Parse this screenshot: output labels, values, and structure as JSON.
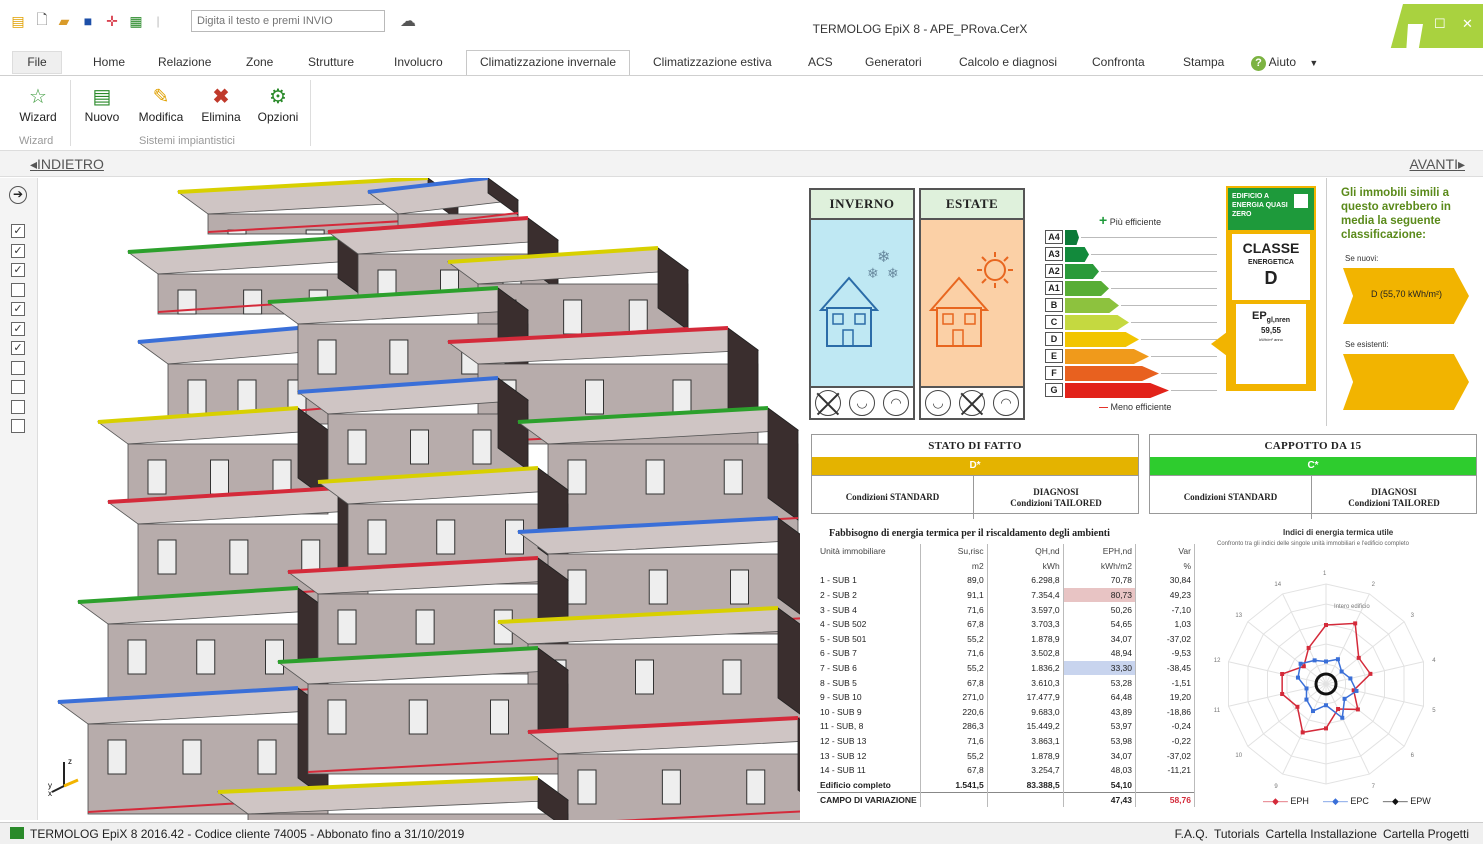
{
  "titlebar": {
    "search_placeholder": "Digita il testo e premi INVIO",
    "window_title": "TERMOLOG EpiX 8 - APE_PRova.CerX"
  },
  "tabs": [
    "File",
    "Home",
    "Relazione",
    "Zone",
    "Strutture",
    "Involucro",
    "Climatizzazione invernale",
    "Climatizzazione estiva",
    "ACS",
    "Generatori",
    "Calcolo e diagnosi",
    "Confronta",
    "Stampa"
  ],
  "help_label": "Aiuto",
  "ribbon": {
    "wizard": "Wizard",
    "nuovo": "Nuovo",
    "modifica": "Modifica",
    "elimina": "Elimina",
    "opzioni": "Opzioni",
    "group_wizard": "Wizard",
    "group_sistemi": "Sistemi impiantistici"
  },
  "nav": {
    "back": "INDIETRO",
    "next": "AVANTI"
  },
  "checkboxes": [
    true,
    true,
    true,
    false,
    true,
    true,
    true,
    false,
    false,
    false,
    false
  ],
  "season": {
    "winter": "INVERNO",
    "summer": "ESTATE",
    "winter_faces": [
      "x",
      "neutral",
      "sad"
    ],
    "summer_faces": [
      "neutral",
      "x",
      "sad"
    ],
    "winter_color": "#bfe8f3",
    "summer_color": "#fbd0a6"
  },
  "energy_scale": {
    "more_efficient": "Più efficiente",
    "less_efficient": "Meno efficiente",
    "classes": [
      "A4",
      "A3",
      "A2",
      "A1",
      "B",
      "C",
      "D",
      "E",
      "F",
      "G"
    ],
    "colors": [
      "#0b7a38",
      "#128a3c",
      "#2a9a3a",
      "#58ad35",
      "#8dc23e",
      "#c5d940",
      "#f2c500",
      "#f09a1b",
      "#e8611f",
      "#e2231a"
    ]
  },
  "classe": {
    "nzeb": "EDIFICIO A ENERGIA QUASI ZERO",
    "classe_label": "CLASSE",
    "energetica": "ENERGETICA",
    "value": "D",
    "ep_label": "EP",
    "ep_sub": "gl,nren",
    "ep_value": "59,55",
    "ep_unit": "kWh/m² anno"
  },
  "similar": {
    "heading": "Gli immobili simili a questo avrebbero in media la seguente classificazione:",
    "new_label": "Se nuovi:",
    "new_value": "D (55,70 kWh/m²)",
    "existing_label": "Se esistenti:"
  },
  "stato": {
    "title": "STATO DI FATTO",
    "class": "D*",
    "cond_standard": "Condizioni STANDARD",
    "diagnosi": "DIAGNOSI",
    "cond_tailored": "Condizioni TAILORED",
    "bar_color": "#e4b300"
  },
  "cappotto": {
    "title": "CAPPOTTO DA 15",
    "class": "C*",
    "cond_standard": "Condizioni STANDARD",
    "diagnosi": "DIAGNOSI",
    "cond_tailored": "Condizioni TAILORED",
    "bar_color": "#2ecc2e"
  },
  "table": {
    "title": "Fabbisogno di energia termica per il riscaldamento degli ambienti",
    "headers": [
      "Unità immobiliare",
      "Su,risc",
      "QH,nd",
      "EPH,nd",
      "Var"
    ],
    "units": [
      "",
      "m2",
      "kWh",
      "kWh/m2",
      "%"
    ],
    "rows": [
      [
        "1 - SUB 1",
        "89,0",
        "6.298,8",
        "70,78",
        "30,84"
      ],
      [
        "2 - SUB 2",
        "91,1",
        "7.354,4",
        "80,73",
        "49,23"
      ],
      [
        "3 - SUB 4",
        "71,6",
        "3.597,0",
        "50,26",
        "-7,10"
      ],
      [
        "4 - SUB 502",
        "67,8",
        "3.703,3",
        "54,65",
        "1,03"
      ],
      [
        "5 - SUB 501",
        "55,2",
        "1.878,9",
        "34,07",
        "-37,02"
      ],
      [
        "6 - SUB 7",
        "71,6",
        "3.502,8",
        "48,94",
        "-9,53"
      ],
      [
        "7 - SUB 6",
        "55,2",
        "1.836,2",
        "33,30",
        "-38,45"
      ],
      [
        "8 - SUB 5",
        "67,8",
        "3.610,3",
        "53,28",
        "-1,51"
      ],
      [
        "9 - SUB 10",
        "271,0",
        "17.477,9",
        "64,48",
        "19,20"
      ],
      [
        "10 - SUB 9",
        "220,6",
        "9.683,0",
        "43,89",
        "-18,86"
      ],
      [
        "11 - SUB, 8",
        "286,3",
        "15.449,2",
        "53,97",
        "-0,24"
      ],
      [
        "12 - SUB 13",
        "71,6",
        "3.863,1",
        "53,98",
        "-0,22"
      ],
      [
        "13 - SUB 12",
        "55,2",
        "1.878,9",
        "34,07",
        "-37,02"
      ],
      [
        "14 - SUB 11",
        "67,8",
        "3.254,7",
        "48,03",
        "-11,21"
      ]
    ],
    "total": [
      "Edificio completo",
      "1.541,5",
      "83.388,5",
      "54,10",
      ""
    ],
    "campo": [
      "CAMPO DI VARIAZIONE",
      "",
      "",
      "47,43",
      "58,76"
    ],
    "highlight_max_color": "#e8c4c4",
    "highlight_min_color": "#c8d4ee"
  },
  "radar": {
    "title": "Indici di energia termica utile",
    "subtitle": "Confronto tra gli indici delle singole unità immobiliari e l'edificio completo",
    "center_label": "Intero edificio",
    "spokes": [
      "1",
      "2",
      "3",
      "4",
      "5",
      "6",
      "7",
      "8",
      "9",
      "10",
      "11",
      "12",
      "13",
      "14"
    ],
    "legend": [
      "EPH",
      "EPC",
      "EPW"
    ],
    "colors": {
      "EPH": "#d42a3a",
      "EPC": "#3a6fd8",
      "EPW": "#111111"
    }
  },
  "status": {
    "left": "TERMOLOG EpiX 8 2016.42 - Codice cliente 74005 - Abbonato fino a 31/10/2019",
    "links": [
      "F.A.Q.",
      "Tutorials",
      "Cartella Installazione",
      "Cartella Progetti"
    ]
  }
}
